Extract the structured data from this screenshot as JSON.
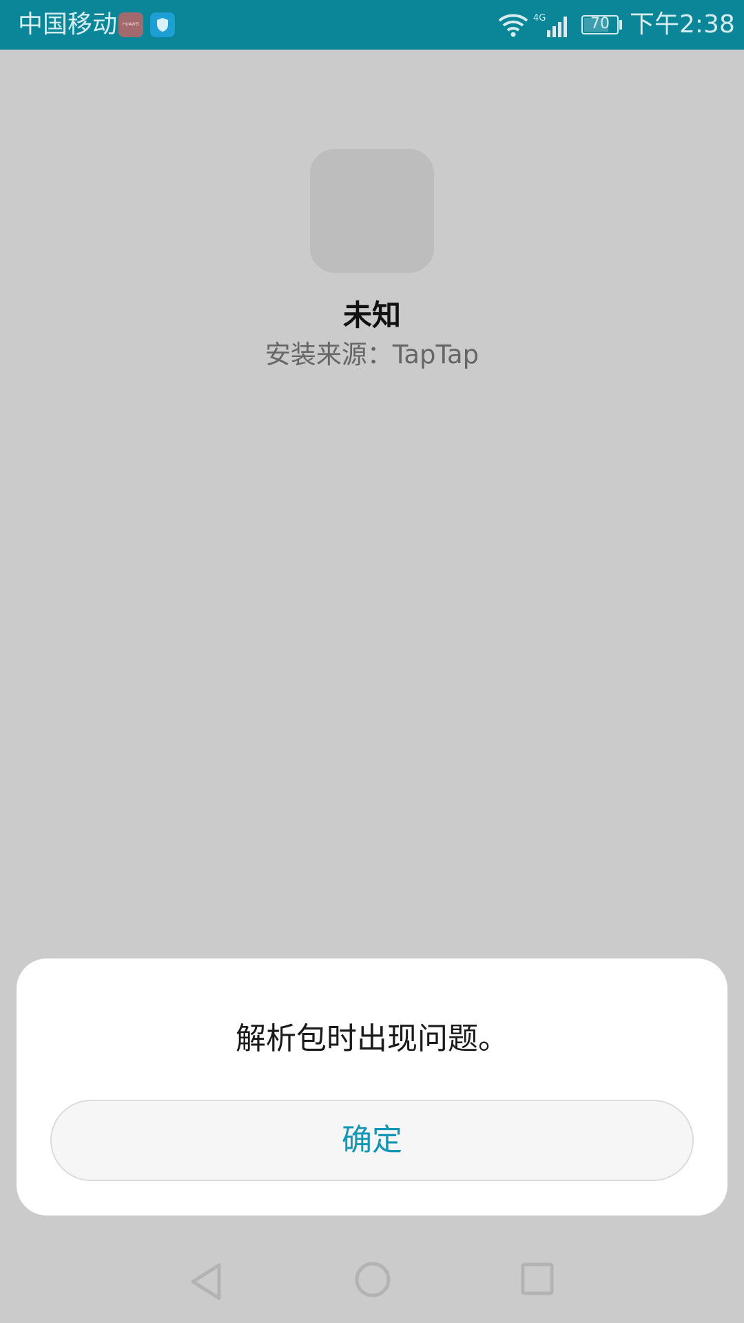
{
  "status_bar": {
    "carrier": "中国移动",
    "huawei_badge_text": "HUAWEI",
    "network": "4G",
    "battery_level": "70",
    "time": "下午2:38",
    "bar_color": "#0a8698"
  },
  "app": {
    "name": "未知",
    "install_source": "安装来源：TapTap"
  },
  "dialog": {
    "message": "解析包时出现问题。",
    "confirm_label": "确定",
    "accent_color": "#1296b3"
  },
  "nav": {
    "back_icon": "back-triangle-icon",
    "home_icon": "home-circle-icon",
    "recent_icon": "recent-square-icon"
  }
}
